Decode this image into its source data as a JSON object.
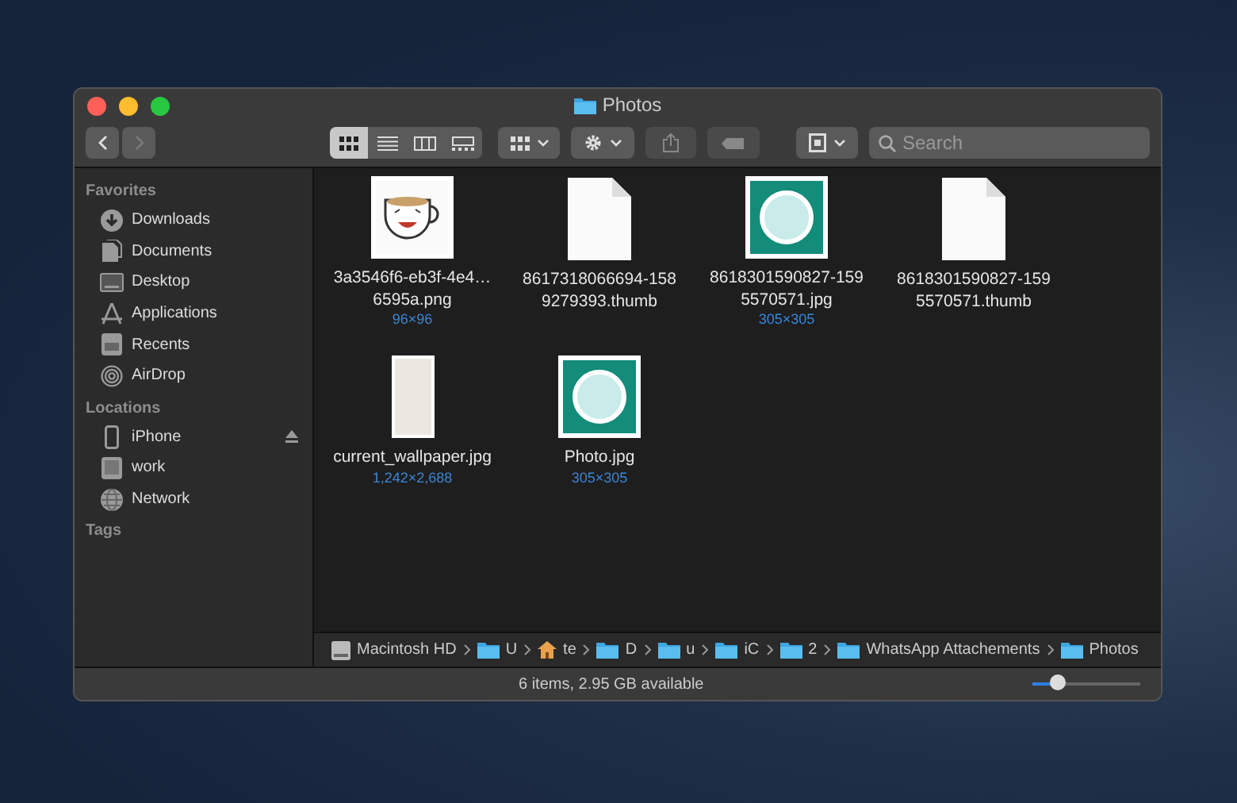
{
  "window": {
    "title": "Photos"
  },
  "toolbar": {
    "view_modes": [
      {
        "selected": true
      },
      {
        "selected": false
      },
      {
        "selected": false
      },
      {
        "selected": false
      }
    ],
    "search": {
      "placeholder": "Search"
    }
  },
  "sidebar": {
    "sections": [
      {
        "title": "Favorites",
        "items": [
          {
            "label": "Downloads",
            "ejectable": false
          },
          {
            "label": "Documents",
            "ejectable": false
          },
          {
            "label": "Desktop",
            "ejectable": false
          },
          {
            "label": "Applications",
            "ejectable": false
          },
          {
            "label": "Recents",
            "ejectable": false
          },
          {
            "label": "AirDrop",
            "ejectable": false
          }
        ]
      },
      {
        "title": "Locations",
        "items": [
          {
            "label": "iPhone",
            "ejectable": true
          },
          {
            "label": "work",
            "ejectable": false
          },
          {
            "label": "Network",
            "ejectable": false
          }
        ]
      },
      {
        "title": "Tags"
      }
    ]
  },
  "files": [
    {
      "kind": "sticker",
      "name": "3a3546f6-eb3f-4e4…6595a.png",
      "dimensions": "96×96"
    },
    {
      "kind": "document",
      "name": "8617318066694-1589279393.thumb"
    },
    {
      "kind": "avatar",
      "name": "8618301590827-1595570571.jpg",
      "dimensions": "305×305"
    },
    {
      "kind": "document",
      "name": "8618301590827-1595570571.thumb"
    },
    {
      "kind": "tall",
      "name": "current_wallpaper.jpg",
      "dimensions": "1,242×2,688"
    },
    {
      "kind": "avatar",
      "name": "Photo.jpg",
      "dimensions": "305×305"
    }
  ],
  "path_bar": [
    {
      "kind": "disk",
      "label": "Macintosh HD"
    },
    {
      "kind": "folder",
      "label": "U"
    },
    {
      "kind": "home",
      "label": "te"
    },
    {
      "kind": "folder",
      "label": "D"
    },
    {
      "kind": "folder",
      "label": "u"
    },
    {
      "kind": "folder",
      "label": "iC"
    },
    {
      "kind": "folder",
      "label": "2"
    },
    {
      "kind": "folder",
      "label": "WhatsApp Attachements"
    },
    {
      "kind": "folder",
      "label": "Photos"
    }
  ],
  "status_bar": {
    "text": "6 items, 2.95 GB available",
    "icon_size": {
      "level": 0.24
    }
  }
}
